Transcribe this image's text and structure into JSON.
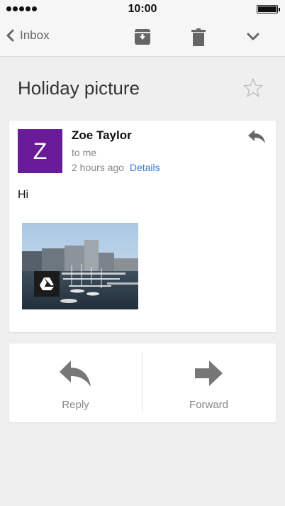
{
  "status_bar": {
    "time": "10:00",
    "signal_icon": "signal-dots-icon",
    "battery_icon": "battery-icon"
  },
  "toolbar": {
    "back_label": "Inbox",
    "back_icon": "chevron-left-icon",
    "archive_icon": "archive-icon",
    "delete_icon": "trash-icon",
    "more_icon": "chevron-down-icon"
  },
  "subject": "Holiday picture",
  "star_icon": "star-outline-icon",
  "message": {
    "avatar_letter": "Z",
    "avatar_color": "#6a1b9a",
    "sender": "Zoe Taylor",
    "recipient": "to me",
    "time": "2 hours ago",
    "details_link": "Details",
    "reply_icon": "reply-icon",
    "body": "Hi",
    "attachment_badge_icon": "google-drive-icon"
  },
  "actions": {
    "reply_label": "Reply",
    "forward_label": "Forward"
  },
  "colors": {
    "link": "#3b78d8",
    "background": "#efefef"
  }
}
